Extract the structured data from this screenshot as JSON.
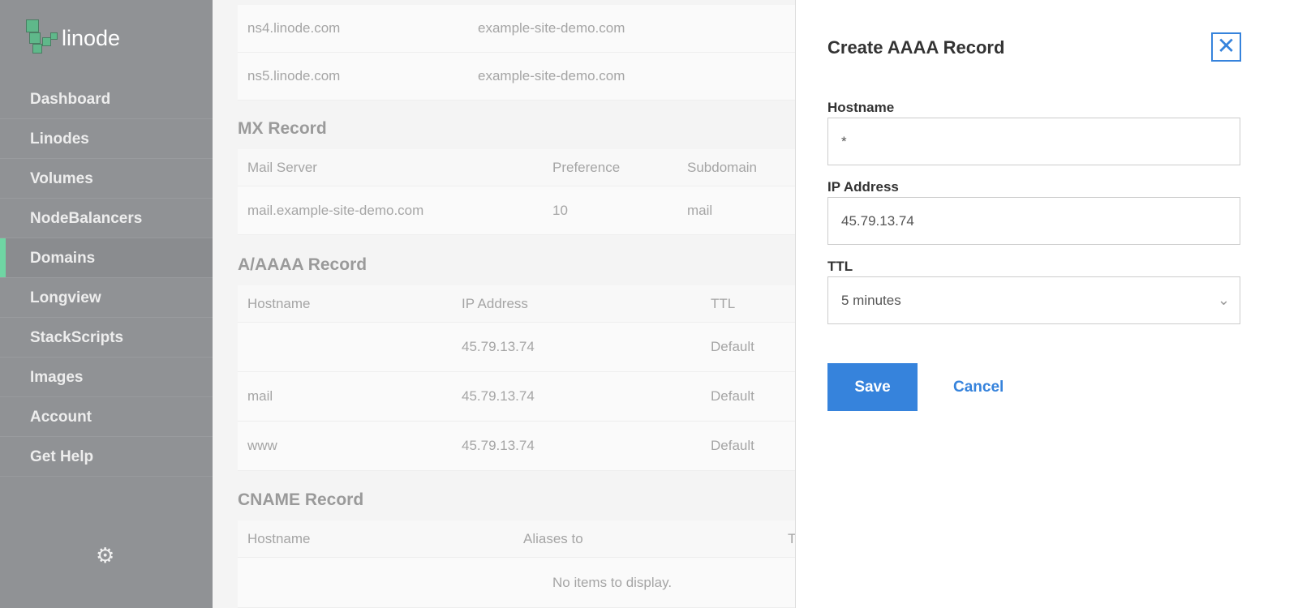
{
  "brand": {
    "name": "linode",
    "accent": "#6fd5a3"
  },
  "sidebar": {
    "items": [
      {
        "label": "Dashboard"
      },
      {
        "label": "Linodes"
      },
      {
        "label": "Volumes"
      },
      {
        "label": "NodeBalancers"
      },
      {
        "label": "Domains",
        "active": true
      },
      {
        "label": "Longview"
      },
      {
        "label": "StackScripts"
      },
      {
        "label": "Images"
      },
      {
        "label": "Account"
      },
      {
        "label": "Get Help"
      }
    ],
    "settings_icon": "gear-icon"
  },
  "ns": {
    "rows": [
      [
        "ns4.linode.com",
        "example-site-demo.com"
      ],
      [
        "ns5.linode.com",
        "example-site-demo.com"
      ]
    ]
  },
  "mx": {
    "title": "MX Record",
    "headers": [
      "Mail Server",
      "Preference",
      "Subdomain"
    ],
    "rows": [
      [
        "mail.example-site-demo.com",
        "10",
        "mail"
      ]
    ]
  },
  "a": {
    "title": "A/AAAA Record",
    "headers": [
      "Hostname",
      "IP Address",
      "TTL"
    ],
    "rows": [
      [
        "",
        "45.79.13.74",
        "Default"
      ],
      [
        "mail",
        "45.79.13.74",
        "Default"
      ],
      [
        "www",
        "45.79.13.74",
        "Default"
      ]
    ]
  },
  "cname": {
    "title": "CNAME Record",
    "headers": [
      "Hostname",
      "Aliases to",
      "TTL"
    ],
    "empty": "No items to display."
  },
  "drawer": {
    "title": "Create AAAA Record",
    "hostname_label": "Hostname",
    "hostname_value": "*",
    "ip_label": "IP Address",
    "ip_value": "45.79.13.74",
    "ttl_label": "TTL",
    "ttl_value": "5 minutes",
    "save": "Save",
    "cancel": "Cancel",
    "primary_color": "#3683dc"
  }
}
